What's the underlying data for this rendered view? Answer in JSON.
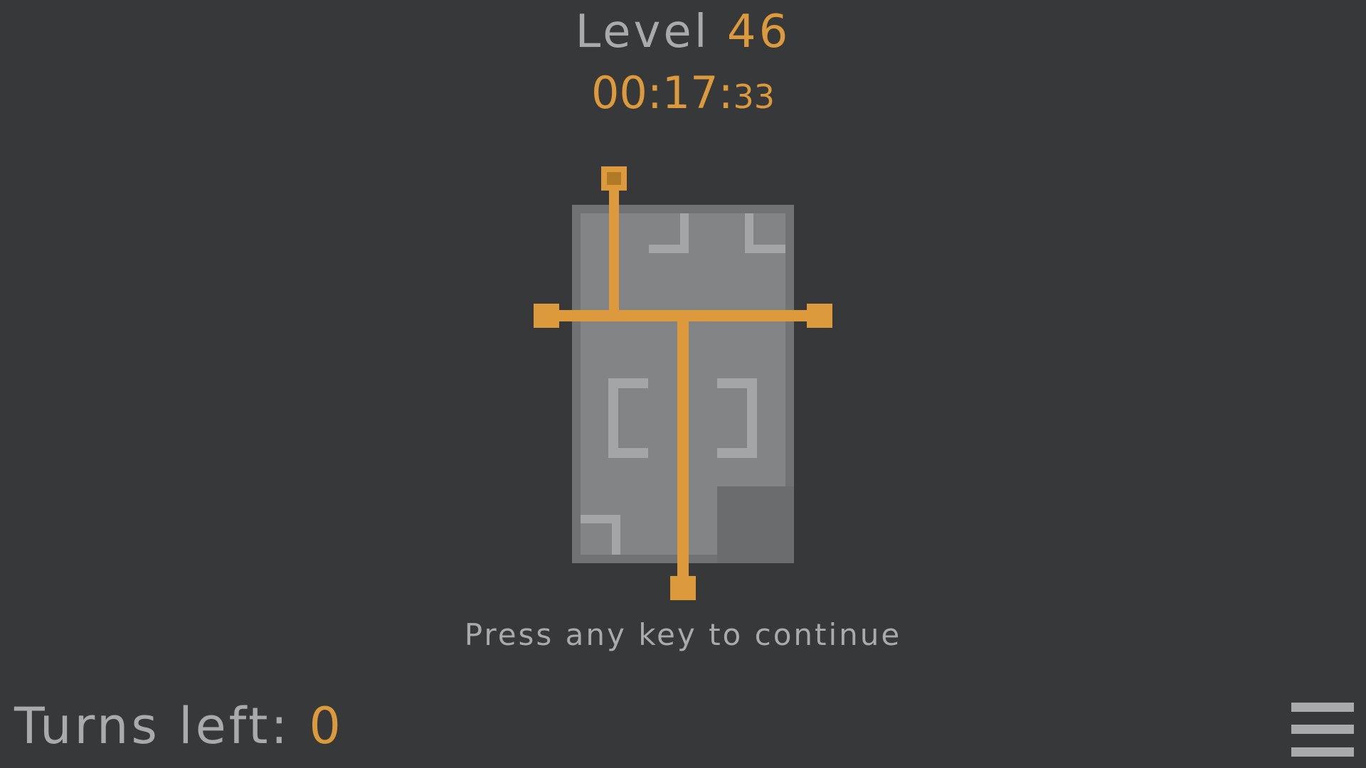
{
  "header": {
    "level_label": "Level",
    "level_number": "46",
    "timer_main": "00:17:",
    "timer_fraction": "33"
  },
  "prompt": "Press any key to continue",
  "footer": {
    "turns_label": "Turns left:",
    "turns_value": "0"
  },
  "icons": {
    "menu": "hamburger-menu-icon"
  },
  "colors": {
    "background": "#363839",
    "accent": "#dc9a3c",
    "text": "#a8aaab",
    "panel": "#828486",
    "panel_border": "#707274",
    "panel_notch": "#6a6c6e",
    "bracket": "#a3a5a6"
  }
}
